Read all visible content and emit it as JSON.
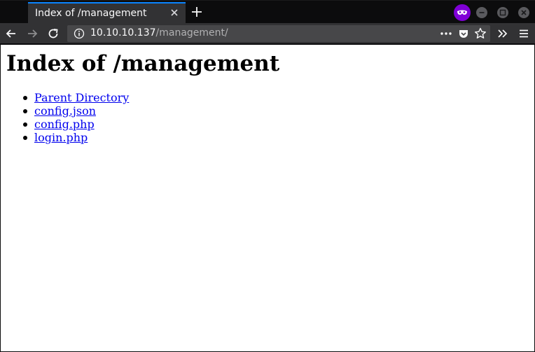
{
  "browser": {
    "tab": {
      "title": "Index of /management"
    },
    "url": {
      "host": "10.10.10.137",
      "path": "/management/"
    },
    "accent_color": "#0a84ff",
    "private_badge_color": "#8000d7",
    "icons": [
      "back-arrow-icon",
      "forward-arrow-icon",
      "reload-icon",
      "info-icon",
      "page-actions-icon",
      "pocket-icon",
      "bookmark-star-icon",
      "overflow-chevron-icon",
      "hamburger-menu-icon",
      "private-browsing-icon"
    ]
  },
  "page": {
    "heading": "Index of /management",
    "links": [
      {
        "label": "Parent Directory"
      },
      {
        "label": "config.json"
      },
      {
        "label": "config.php"
      },
      {
        "label": "login.php"
      }
    ],
    "link_color": "#0000ee"
  }
}
